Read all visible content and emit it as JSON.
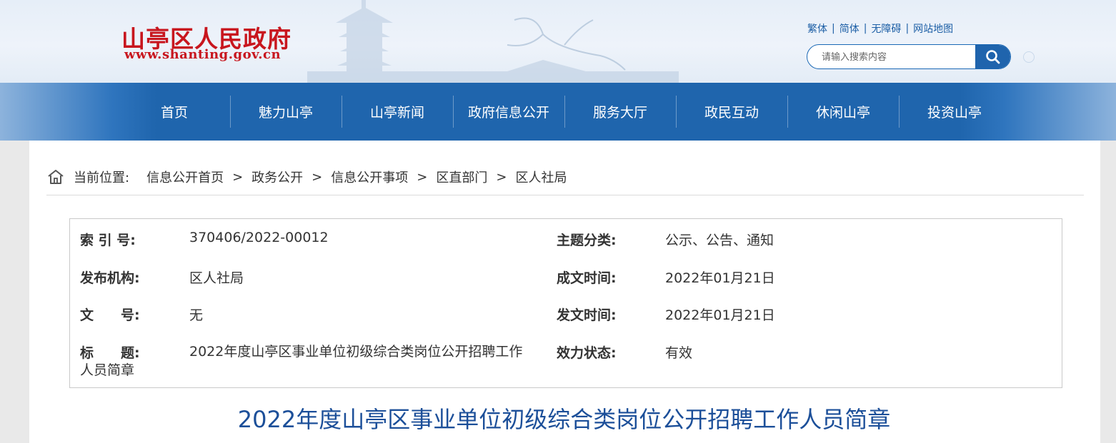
{
  "site": {
    "title": "山亭区人民政府",
    "url": "www.shanting.gov.cn"
  },
  "toplinks": [
    "繁体",
    "简体",
    "无障碍",
    "网站地图"
  ],
  "toplink_separator": "|",
  "search": {
    "placeholder": "请输入搜索内容",
    "icon": "search-icon"
  },
  "nav": [
    "首页",
    "魅力山亭",
    "山亭新闻",
    "政府信息公开",
    "服务大厅",
    "政民互动",
    "休闲山亭",
    "投资山亭"
  ],
  "breadcrumb": {
    "icon": "home-icon",
    "label": "当前位置:",
    "items": [
      "信息公开首页",
      "政务公开",
      "信息公开事项",
      "区直部门",
      "区人社局"
    ],
    "separator": ">"
  },
  "meta": {
    "index_label": "索 引 号:",
    "index_value": "370406/2022-00012",
    "topic_label": "主题分类:",
    "topic_value": "公示、公告、通知",
    "publisher_label": "发布机构:",
    "publisher_value": "区人社局",
    "created_label": "成文时间:",
    "created_value": "2022年01月21日",
    "docno_label": "文　　号:",
    "docno_value": "无",
    "issued_label": "发文时间:",
    "issued_value": "2022年01月21日",
    "title_label": "标　　题:",
    "title_value": "2022年度山亭区事业单位初级综合类岗位公开招聘工作人员简章",
    "status_label": "效力状态:",
    "status_value": "有效"
  },
  "article": {
    "headline": "2022年度山亭区事业单位初级综合类岗位公开招聘工作人员简章"
  },
  "colors": {
    "brand_red": "#c8161e",
    "nav_blue": "#1f65ad",
    "headline_blue": "#1c4f99"
  }
}
